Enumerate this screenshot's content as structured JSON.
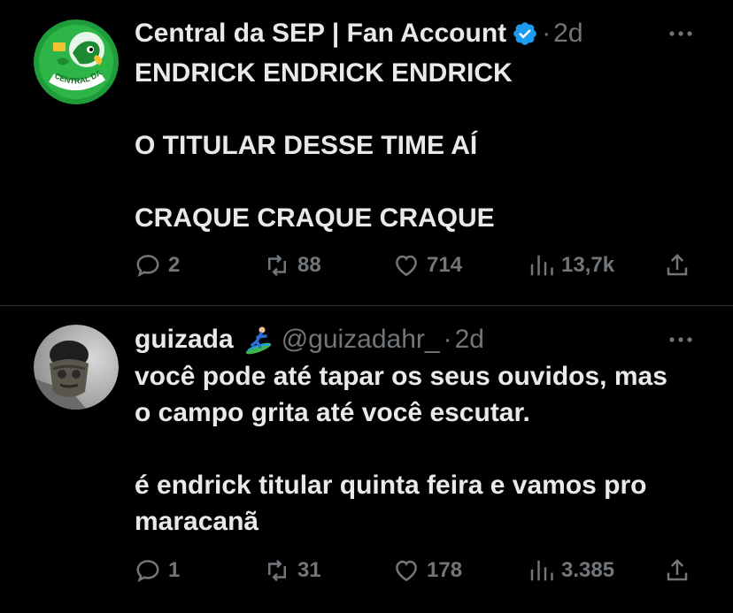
{
  "tweets": [
    {
      "author_name": "Central da SEP | Fan Account",
      "handle": "",
      "separator": "·",
      "time": "2d",
      "avatar_text": "CENTRAL DA SEP",
      "lines": [
        "ENDRICK ENDRICK ENDRICK",
        "",
        "O TITULAR DESSE TIME AÍ",
        "",
        "CRAQUE CRAQUE CRAQUE"
      ],
      "replies": "2",
      "retweets": "88",
      "likes": "714",
      "views": "13,7k",
      "verified": true
    },
    {
      "author_name": "guizada",
      "handle": "@guizadahr_",
      "separator": "·",
      "time": "2d",
      "lines": [
        "você pode até tapar os seus ouvidos, mas",
        "o campo grita até você escutar.",
        "",
        "é endrick titular quinta feira e vamos pro",
        "maracanã"
      ],
      "replies": "1",
      "retweets": "31",
      "likes": "178",
      "views": "3.385",
      "verified": false
    }
  ],
  "colors": {
    "background": "#000000",
    "text": "#e7e9ea",
    "muted": "#71767b",
    "verified": "#1d9bf0",
    "divider": "#2f3336"
  }
}
